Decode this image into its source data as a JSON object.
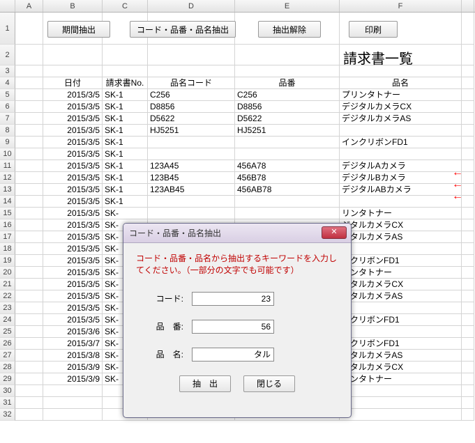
{
  "columns": [
    "A",
    "B",
    "C",
    "D",
    "E",
    "F"
  ],
  "buttons": {
    "period": "期間抽出",
    "code": "コード・品番・品名抽出",
    "release": "抽出解除",
    "print": "印刷"
  },
  "title": "請求書一覧",
  "headers": {
    "date": "日付",
    "invoice": "請求書No.",
    "code": "品名コード",
    "partno": "品番",
    "name": "品名"
  },
  "rows": [
    {
      "n": "5",
      "date": "2015/3/5",
      "inv": "SK-1",
      "code": "C256",
      "part": "C256",
      "name": "プリンタトナー"
    },
    {
      "n": "6",
      "date": "2015/3/5",
      "inv": "SK-1",
      "code": "D8856",
      "part": "D8856",
      "name": "デジタルカメラCX"
    },
    {
      "n": "7",
      "date": "2015/3/5",
      "inv": "SK-1",
      "code": "D5622",
      "part": "D5622",
      "name": "デジタルカメラAS"
    },
    {
      "n": "8",
      "date": "2015/3/5",
      "inv": "SK-1",
      "code": "HJ5251",
      "part": "HJ5251",
      "name": ""
    },
    {
      "n": "9",
      "date": "2015/3/5",
      "inv": "SK-1",
      "code": "",
      "part": "",
      "name": "インクリボンFD1"
    },
    {
      "n": "10",
      "date": "2015/3/5",
      "inv": "SK-1",
      "code": "",
      "part": "",
      "name": ""
    },
    {
      "n": "11",
      "date": "2015/3/5",
      "inv": "SK-1",
      "code": "123A45",
      "part": "456A78",
      "name": "デジタルAカメラ"
    },
    {
      "n": "12",
      "date": "2015/3/5",
      "inv": "SK-1",
      "code": "123B45",
      "part": "456B78",
      "name": "デジタルBカメラ"
    },
    {
      "n": "13",
      "date": "2015/3/5",
      "inv": "SK-1",
      "code": "123AB45",
      "part": "456AB78",
      "name": "デジタルABカメラ"
    },
    {
      "n": "14",
      "date": "2015/3/5",
      "inv": "SK-1",
      "code": "",
      "part": "",
      "name": ""
    },
    {
      "n": "15",
      "date": "2015/3/5",
      "inv": "SK-",
      "code": "",
      "part": "",
      "name": "リンタトナー"
    },
    {
      "n": "16",
      "date": "2015/3/5",
      "inv": "SK-",
      "code": "",
      "part": "",
      "name": "ジタルカメラCX"
    },
    {
      "n": "17",
      "date": "2015/3/5",
      "inv": "SK-",
      "code": "",
      "part": "",
      "name": "ジタルカメラAS"
    },
    {
      "n": "18",
      "date": "2015/3/5",
      "inv": "SK-",
      "code": "",
      "part": "",
      "name": ""
    },
    {
      "n": "19",
      "date": "2015/3/5",
      "inv": "SK-",
      "code": "",
      "part": "",
      "name": "ンクリボンFD1"
    },
    {
      "n": "20",
      "date": "2015/3/5",
      "inv": "SK-",
      "code": "",
      "part": "",
      "name": "リンタトナー"
    },
    {
      "n": "21",
      "date": "2015/3/5",
      "inv": "SK-",
      "code": "",
      "part": "",
      "name": "ジタルカメラCX"
    },
    {
      "n": "22",
      "date": "2015/3/5",
      "inv": "SK-",
      "code": "",
      "part": "",
      "name": "ジタルカメラAS"
    },
    {
      "n": "23",
      "date": "2015/3/5",
      "inv": "SK-",
      "code": "",
      "part": "",
      "name": ""
    },
    {
      "n": "24",
      "date": "2015/3/5",
      "inv": "SK-",
      "code": "",
      "part": "",
      "name": "ンクリボンFD1"
    },
    {
      "n": "25",
      "date": "2015/3/6",
      "inv": "SK-",
      "code": "",
      "part": "",
      "name": ""
    },
    {
      "n": "26",
      "date": "2015/3/7",
      "inv": "SK-",
      "code": "",
      "part": "",
      "name": "ンクリボンFD1"
    },
    {
      "n": "27",
      "date": "2015/3/8",
      "inv": "SK-",
      "code": "",
      "part": "",
      "name": "ジタルカメラAS"
    },
    {
      "n": "28",
      "date": "2015/3/9",
      "inv": "SK-",
      "code": "",
      "part": "",
      "name": "ジタルカメラCX"
    },
    {
      "n": "29",
      "date": "2015/3/9",
      "inv": "SK-",
      "code": "",
      "part": "",
      "name": "リンタトナー"
    },
    {
      "n": "30",
      "date": "",
      "inv": "",
      "code": "",
      "part": "",
      "name": ""
    },
    {
      "n": "31",
      "date": "",
      "inv": "",
      "code": "",
      "part": "",
      "name": ""
    },
    {
      "n": "32",
      "date": "",
      "inv": "",
      "code": "",
      "part": "",
      "name": ""
    }
  ],
  "dialog": {
    "title": "コード・品番・品名抽出",
    "message": "コード・品番・品名から抽出するキーワードを入力してください。（一部分の文字でも可能です）",
    "labels": {
      "code": "コード:",
      "partno": "品　番:",
      "name": "品　名:"
    },
    "values": {
      "code": "23",
      "partno": "56",
      "name": "タル"
    },
    "buttons": {
      "extract": "抽　出",
      "close": "閉じる"
    }
  }
}
